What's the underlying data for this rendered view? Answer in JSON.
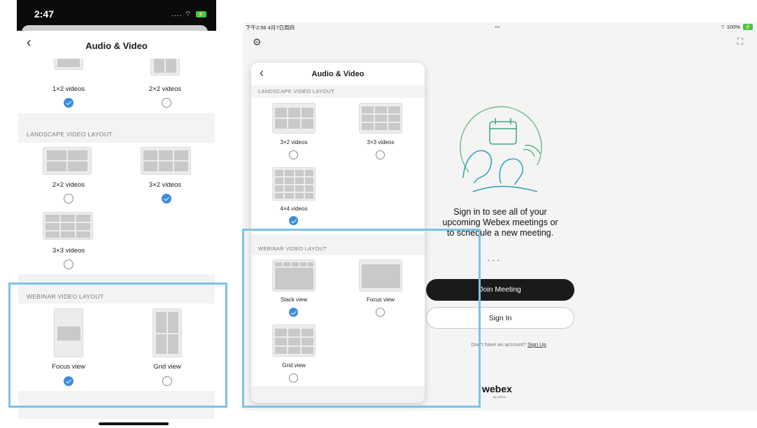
{
  "phone": {
    "status": {
      "time": "2:47",
      "signal": "....",
      "battery": "⚡"
    },
    "title": "Audio & Video",
    "top_options": [
      {
        "label": "1×2 videos",
        "selected": true
      },
      {
        "label": "2×2 videos",
        "selected": false
      }
    ],
    "landscape": {
      "header": "LANDSCAPE VIDEO LAYOUT",
      "options": [
        {
          "label": "2×2 videos",
          "selected": false
        },
        {
          "label": "3×2 videos",
          "selected": true
        },
        {
          "label": "3×3 videos",
          "selected": false
        }
      ]
    },
    "webinar": {
      "header": "WEBINAR VIDEO LAYOUT",
      "options": [
        {
          "label": "Focus view",
          "selected": true
        },
        {
          "label": "Grid view",
          "selected": false
        }
      ]
    }
  },
  "tablet": {
    "status": {
      "time": "下午2:56  4月7日周四",
      "dots": "•••",
      "battery": "100%"
    },
    "popover": {
      "title": "Audio & Video",
      "landscape_header": "LANDSCAPE VIDEO LAYOUT",
      "landscape_options": [
        {
          "label": "3×2 videos",
          "selected": false
        },
        {
          "label": "3×3 videos",
          "selected": false
        },
        {
          "label": "4×4 videos",
          "selected": true
        }
      ],
      "webinar_header": "WEBINAR VIDEO LAYOUT",
      "webinar_options": [
        {
          "label": "Stack view",
          "selected": true
        },
        {
          "label": "Focus view",
          "selected": false
        },
        {
          "label": "Grid view",
          "selected": false
        }
      ]
    },
    "signin": {
      "line1": "Sign in to see all of your",
      "line2": "upcoming Webex meetings or",
      "line3": "to schedule a new meeting.",
      "pager": "• • •",
      "join_label": "Join Meeting",
      "signin_label": "Sign In",
      "account_text": "Don't have an account?",
      "signup_link": "Sign Up",
      "brand": "webex",
      "brand_sub": "by CISCO"
    }
  },
  "colors": {
    "accent": "#3b8ce0",
    "highlight": "#7cc3e6"
  }
}
